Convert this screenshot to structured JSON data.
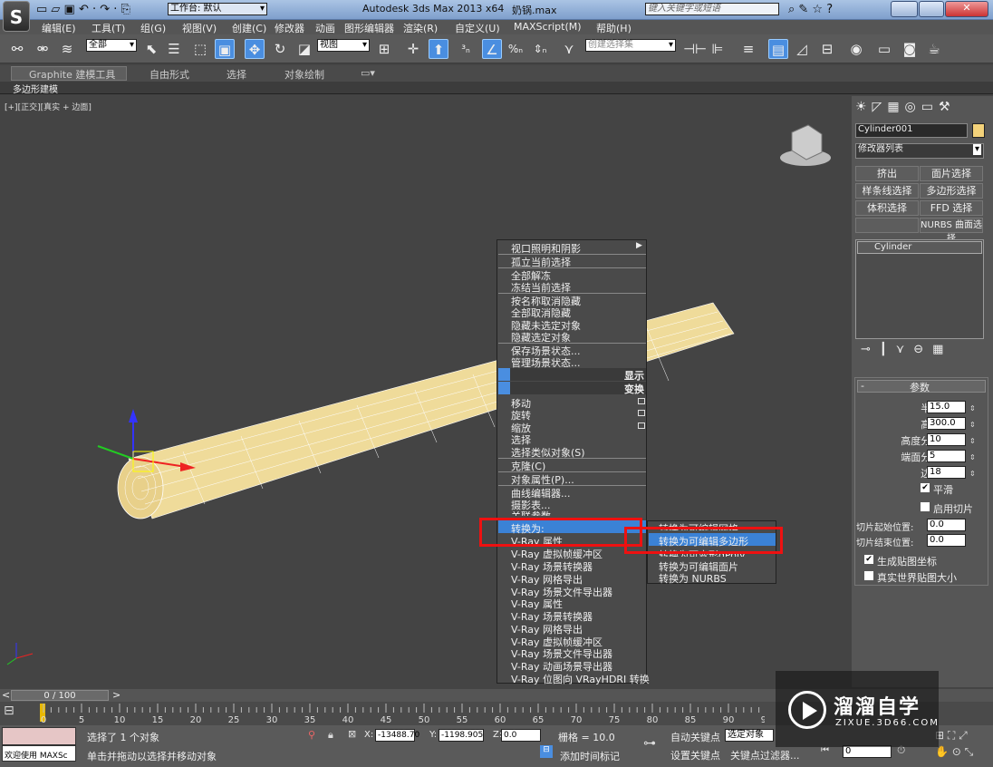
{
  "title": {
    "workspace_label": "工作台: 默认",
    "app": "Autodesk 3ds Max  2013 x64",
    "file": "奶锅.max",
    "search_placeholder": "键入关键字或短语"
  },
  "menu": [
    "编辑(E)",
    "工具(T)",
    "组(G)",
    "视图(V)",
    "创建(C)",
    "修改器",
    "动画",
    "图形编辑器",
    "渲染(R)",
    "自定义(U)",
    "MAXScript(M)",
    "帮助(H)"
  ],
  "toolbar": {
    "filter": "全部",
    "refcoord": "视图",
    "selset": "创建选择集"
  },
  "ribbon": {
    "tabs": [
      "Graphite 建模工具",
      "自由形式",
      "选择",
      "对象绘制"
    ],
    "sub": "多边形建模"
  },
  "viewport": {
    "label": "[+][正交][真实 + 边面]"
  },
  "context_menu": {
    "items": [
      "视口照明和阴影",
      "孤立当前选择",
      "全部解冻",
      "冻结当前选择",
      "按名称取消隐藏",
      "全部取消隐藏",
      "隐藏未选定对象",
      "隐藏选定对象",
      "保存场景状态...",
      "管理场景状态..."
    ],
    "headers": [
      "显示",
      "变换"
    ],
    "items2": [
      "移动",
      "旋转",
      "缩放",
      "选择",
      "选择类似对象(S)",
      "克隆(C)",
      "对象属性(P)...",
      "曲线编辑器...",
      "摄影表...",
      "关联参数",
      "转换为:",
      "V-Ray 属性",
      "V-Ray 虚拟帧缓冲区",
      "V-Ray 场景转换器",
      "V-Ray 网格导出",
      "V-Ray 场景文件导出器",
      "V-Ray 属性",
      "V-Ray 场景转换器",
      "V-Ray 网格导出",
      "V-Ray 虚拟帧缓冲区",
      "V-Ray 场景文件导出器",
      "V-Ray 动画场景导出器",
      "V-Ray 位图向 VRayHDRI 转换"
    ]
  },
  "submenu": {
    "items": [
      "转换为可编辑网格",
      "转换为可编辑多边形",
      "转换为可变形gPoly",
      "转换为可编辑面片",
      "转换为 NURBS"
    ]
  },
  "panel": {
    "object_name": "Cylinder001",
    "modifier_list": "修改器列表",
    "buttons": [
      "挤出",
      "面片选择",
      "样条线选择",
      "多边形选择",
      "体积选择",
      "FFD 选择",
      "",
      "NURBS 曲面选择"
    ],
    "stack": "Cylinder",
    "rollout": "参数",
    "params": [
      {
        "label": "半径:",
        "value": "15.0"
      },
      {
        "label": "高度:",
        "value": "300.0"
      },
      {
        "label": "高度分段:",
        "value": "10"
      },
      {
        "label": "端面分段:",
        "value": "5"
      },
      {
        "label": "边数:",
        "value": "18"
      }
    ],
    "smooth": "平滑",
    "slice": "启用切片",
    "slice_from": {
      "label": "切片起始位置:",
      "value": "0.0"
    },
    "slice_to": {
      "label": "切片结束位置:",
      "value": "0.0"
    },
    "gen_map": "生成贴图坐标",
    "real_world": "真实世界贴图大小"
  },
  "timeline": {
    "frame": "0 / 100",
    "ticks": [
      "0",
      "5",
      "10",
      "15",
      "20",
      "25",
      "30",
      "35",
      "40",
      "45",
      "50",
      "55",
      "60",
      "65",
      "70",
      "75",
      "80",
      "85",
      "90",
      "95"
    ]
  },
  "status": {
    "welcome": "欢迎使用 MAXSc",
    "selected": "选择了 1 个对象",
    "hint": "单击并拖动以选择并移动对象",
    "x": "-13488.70",
    "y": "-1198.905",
    "z": "0.0",
    "grid": "栅格 = 10.0",
    "autokey": "自动关键点",
    "setkey": "设置关键点",
    "sel_obj": "选定对象",
    "add_tag": "添加时间标记",
    "key_filter": "关键点过滤器...",
    "frame": "0"
  },
  "watermark": {
    "name": "溜溜自学",
    "url": "ZIXUE.3D66.COM"
  }
}
